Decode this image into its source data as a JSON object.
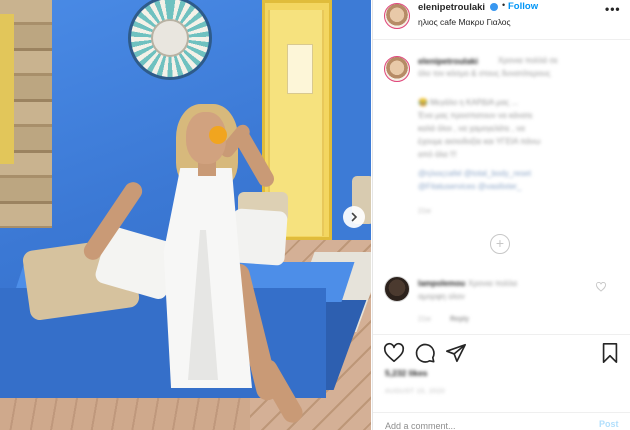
{
  "post_header": {
    "username": "elenipetroulaki",
    "separator": "•",
    "follow_label": "Follow",
    "location": "ηλιος cafe Μακρυ Γιαλος",
    "more_label": "•••"
  },
  "caption": {
    "username": "elenipetroulaki",
    "lines": [
      "Χρονια πολλά σε",
      "όλο τον κόσμο & στους δυνατότερους",
      "😂",
      "Μεγάλο η ΚΑΡΔΙΑ μας ...",
      "Ένα μας προσπατουν να κάνατε",
      "καλά όλοι , να χαμογελάτε , να",
      "έχουμε αισιοδοξία και ΥΓΕΙΑ πάνω",
      "από όλα !!!"
    ],
    "tags_line1": "@ηλιοςcafel @total_body_reset",
    "tags_line2": "@Fitatuservices @vasilixter_",
    "time": "21w"
  },
  "load_more_symbol": "+",
  "comment": {
    "username": "lampolemou",
    "text_line1": "Χρονια πολλα",
    "text_line2": "αμορφη ολον",
    "time": "21w",
    "reply_label": "Reply"
  },
  "stats": {
    "likes": "5,232 likes",
    "date": "AUGUST 15, 2020"
  },
  "comment_box": {
    "placeholder": "Add a comment...",
    "post_label": "Post"
  },
  "colors": {
    "accent": "#0095f6",
    "verified": "#3897f0",
    "post_disabled": "#b2dffc",
    "wall_blue": "#3f7fd6",
    "door_yellow": "#f3d661"
  },
  "icons": {
    "carousel_next": "chevron-right-icon",
    "like": "heart-icon",
    "comment": "comment-icon",
    "share": "paper-plane-icon",
    "save": "bookmark-icon"
  }
}
